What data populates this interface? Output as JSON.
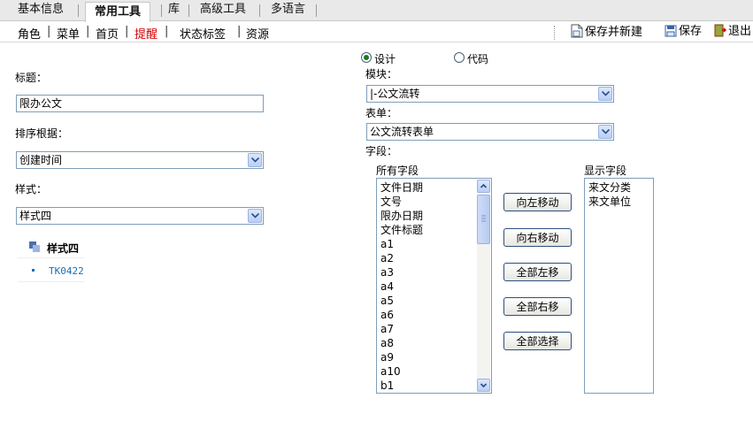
{
  "tabs": [
    "基本信息",
    "常用工具",
    "库",
    "高级工具",
    "多语言"
  ],
  "active_tab": "常用工具",
  "sub_links": [
    "角色",
    "菜单",
    "首页",
    "提醒",
    "状态标签",
    "资源"
  ],
  "sub_active": "提醒",
  "toolbar": {
    "save_new": "保存并新建",
    "save": "保存",
    "exit": "退出"
  },
  "form": {
    "title_label": "标题：",
    "title_value": "限办公文",
    "sort_label": "排序根据：",
    "sort_value": "创建时间",
    "style_label": "样式：",
    "style_value": "样式四"
  },
  "preview": {
    "title": "样式四",
    "item": "TK0422"
  },
  "mode": {
    "design": "设计",
    "code": "代码",
    "selected": "design"
  },
  "module": {
    "label": "模块：",
    "value": "|-公文流转"
  },
  "form_select": {
    "label": "表单：",
    "value": "公文流转表单"
  },
  "fields": {
    "label": "字段：",
    "all_label": "所有字段",
    "all_items": [
      "文件日期",
      "文号",
      "限办日期",
      "文件标题",
      "a1",
      "a2",
      "a3",
      "a4",
      "a5",
      "a6",
      "a7",
      "a8",
      "a9",
      "a10",
      "b1"
    ],
    "display_label": "显示字段",
    "display_items": [
      "来文分类",
      "来文单位"
    ]
  },
  "buttons": {
    "move_left": "向左移动",
    "move_right": "向右移动",
    "all_left": "全部左移",
    "all_right": "全部右移",
    "select_all": "全部选择"
  },
  "colors": {
    "active_link": "#d20000",
    "preview_item": "#1b6fb8",
    "border": "#7f9db9"
  }
}
